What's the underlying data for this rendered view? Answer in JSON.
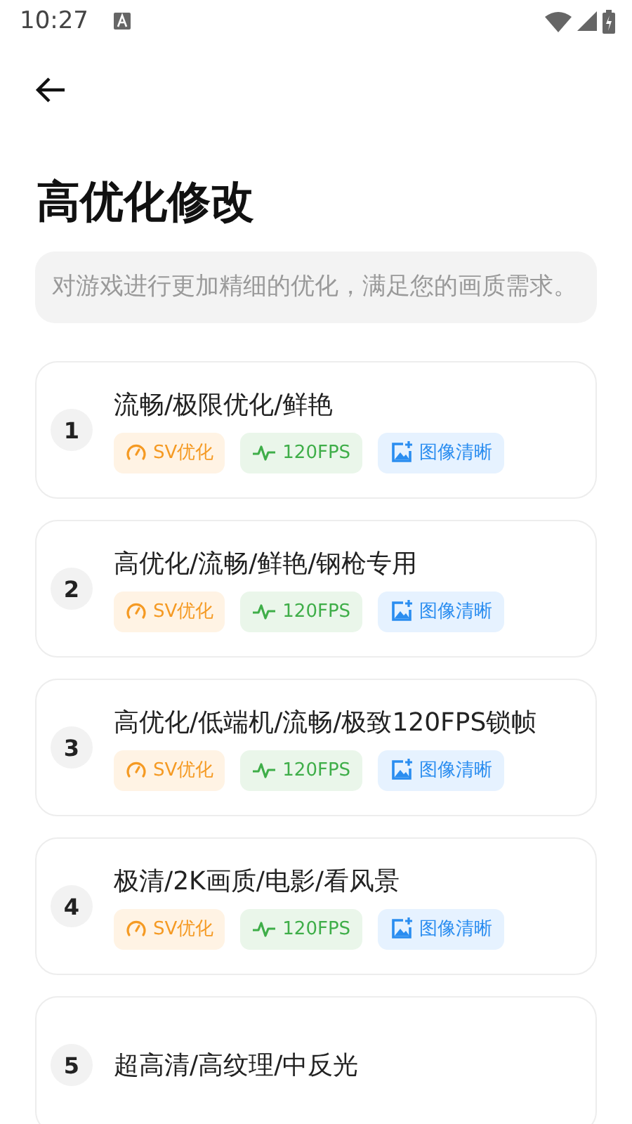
{
  "status_bar": {
    "time": "10:27"
  },
  "title": "高优化修改",
  "description": "对游戏进行更加精细的优化，满足您的画质需求。",
  "presets": [
    {
      "number": "1",
      "name": "流畅/极限优化/鲜艳",
      "tags": [
        {
          "kind": "sv",
          "label": "SV优化"
        },
        {
          "kind": "fps",
          "label": "120FPS"
        },
        {
          "kind": "image",
          "label": "图像清晰"
        }
      ]
    },
    {
      "number": "2",
      "name": "高优化/流畅/鲜艳/钢枪专用",
      "tags": [
        {
          "kind": "sv",
          "label": "SV优化"
        },
        {
          "kind": "fps",
          "label": "120FPS"
        },
        {
          "kind": "image",
          "label": "图像清晰"
        }
      ]
    },
    {
      "number": "3",
      "name": "高优化/低端机/流畅/极致120FPS锁帧",
      "tags": [
        {
          "kind": "sv",
          "label": "SV优化"
        },
        {
          "kind": "fps",
          "label": "120FPS"
        },
        {
          "kind": "image",
          "label": "图像清晰"
        }
      ]
    },
    {
      "number": "4",
      "name": "极清/2K画质/电影/看风景",
      "tags": [
        {
          "kind": "sv",
          "label": "SV优化"
        },
        {
          "kind": "fps",
          "label": "120FPS"
        },
        {
          "kind": "image",
          "label": "图像清晰"
        }
      ]
    },
    {
      "number": "5",
      "name": "超高清/高纹理/中反光"
    }
  ]
}
